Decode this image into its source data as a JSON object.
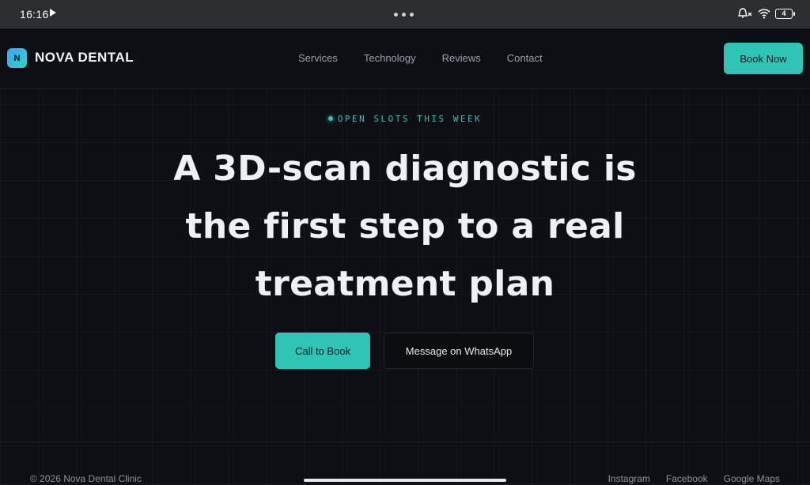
{
  "status_bar": {
    "time": "16:16",
    "battery": "4"
  },
  "nav": {
    "logo_letter": "N",
    "brand": "NOVA DENTAL",
    "links": [
      "Services",
      "Technology",
      "Reviews",
      "Contact"
    ],
    "book_label": "Book Now"
  },
  "hero": {
    "eyebrow": "OPEN SLOTS THIS WEEK",
    "title": "A 3D-scan diagnostic is the first step to a real treatment plan",
    "cta_primary": "Call to Book",
    "cta_secondary": "Message on WhatsApp"
  },
  "footer": {
    "copyright": "© 2026 Nova Dental Clinic",
    "links": [
      "Instagram",
      "Facebook",
      "Google Maps"
    ]
  },
  "colors": {
    "accent": "#2ec4b6",
    "background": "#0d0f14"
  }
}
